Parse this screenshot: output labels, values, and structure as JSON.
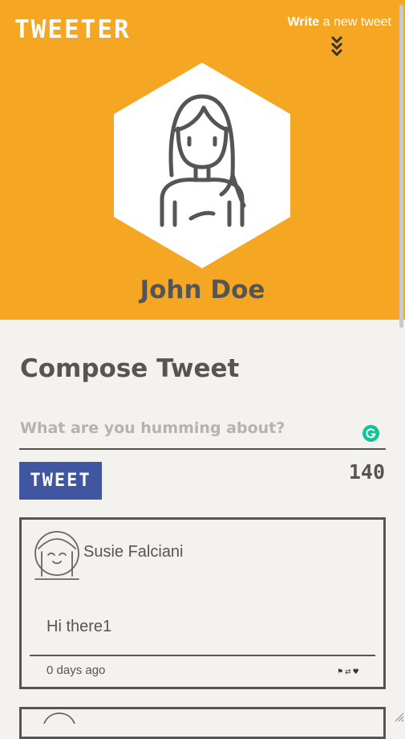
{
  "header": {
    "brand": "TWEETER",
    "write_bold": "Write",
    "write_rest": " a new tweet",
    "profile_name": "John Doe",
    "background_color": "#f5a623"
  },
  "compose": {
    "title": "Compose Tweet",
    "placeholder": "What are you humming about?",
    "value": "",
    "button_label": "TWEET",
    "button_color": "#4056a1",
    "char_count": "140"
  },
  "tweets": [
    {
      "author": "Susie Falciani",
      "text": "Hi there1",
      "time": "0 days ago",
      "actions": [
        "flag-icon",
        "retweet-icon",
        "heart-icon"
      ]
    }
  ],
  "icons": {
    "write_toggle": "double-chevron-down-icon",
    "grammarly": "grammarly-icon",
    "resize": "resize-grip-icon"
  }
}
